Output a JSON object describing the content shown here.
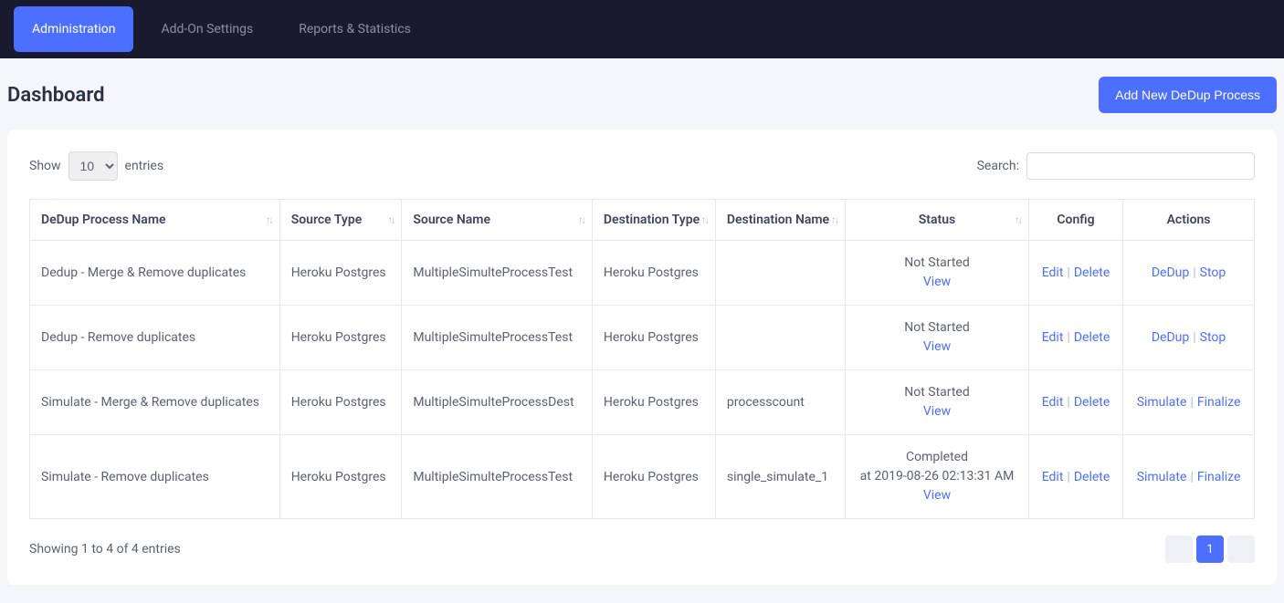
{
  "nav": {
    "tabs": [
      "Administration",
      "Add-On Settings",
      "Reports & Statistics"
    ],
    "active": 0
  },
  "header": {
    "title": "Dashboard",
    "add_button": "Add New DeDup Process"
  },
  "lengthMenu": {
    "show": "Show",
    "entries": "entries",
    "value": "10"
  },
  "search": {
    "label": "Search:"
  },
  "columns": [
    "DeDup Process Name",
    "Source Type",
    "Source Name",
    "Destination Type",
    "Destination Name",
    "Status",
    "Config",
    "Actions"
  ],
  "configLinks": {
    "edit": "Edit",
    "delete": "Delete"
  },
  "statusView": "View",
  "rows": [
    {
      "name": "Dedup - Merge & Remove duplicates",
      "sourceType": "Heroku Postgres",
      "sourceName": "MultipleSimulteProcessTest",
      "destType": "Heroku Postgres",
      "destName": "",
      "statusLine1": "Not Started",
      "statusLine2": "",
      "actions": [
        "DeDup",
        "Stop"
      ]
    },
    {
      "name": "Dedup - Remove duplicates",
      "sourceType": "Heroku Postgres",
      "sourceName": "MultipleSimulteProcessTest",
      "destType": "Heroku Postgres",
      "destName": "",
      "statusLine1": "Not Started",
      "statusLine2": "",
      "actions": [
        "DeDup",
        "Stop"
      ]
    },
    {
      "name": "Simulate - Merge & Remove duplicates",
      "sourceType": "Heroku Postgres",
      "sourceName": "MultipleSimulteProcessDest",
      "destType": "Heroku Postgres",
      "destName": "processcount",
      "statusLine1": "Not Started",
      "statusLine2": "",
      "actions": [
        "Simulate",
        "Finalize"
      ]
    },
    {
      "name": "Simulate - Remove duplicates",
      "sourceType": "Heroku Postgres",
      "sourceName": "MultipleSimulteProcessTest",
      "destType": "Heroku Postgres",
      "destName": "single_simulate_1",
      "statusLine1": "Completed",
      "statusLine2": "at 2019-08-26 02:13:31 AM",
      "actions": [
        "Simulate",
        "Finalize"
      ]
    }
  ],
  "info": "Showing 1 to 4 of 4 entries",
  "pagination": {
    "current": "1"
  }
}
